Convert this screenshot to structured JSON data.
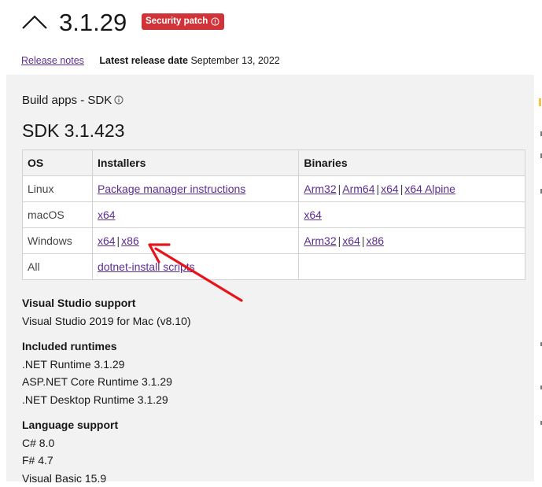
{
  "header": {
    "version": "3.1.29",
    "badge_label": "Security patch",
    "release_notes_link": "Release notes",
    "latest_release_label": "Latest release date",
    "latest_release_date": "September 13, 2022"
  },
  "sdk": {
    "section_title": "Build apps - SDK",
    "title": "SDK 3.1.423",
    "table": {
      "headers": [
        "OS",
        "Installers",
        "Binaries"
      ],
      "rows": [
        {
          "os": "Linux",
          "installers": [
            "Package manager instructions"
          ],
          "binaries": [
            "Arm32",
            "Arm64",
            "x64",
            "x64 Alpine"
          ]
        },
        {
          "os": "macOS",
          "installers": [
            "x64"
          ],
          "binaries": [
            "x64"
          ]
        },
        {
          "os": "Windows",
          "installers": [
            "x64",
            "x86"
          ],
          "binaries": [
            "Arm32",
            "x64",
            "x86"
          ]
        },
        {
          "os": "All",
          "installers": [
            "dotnet-install scripts"
          ],
          "binaries": []
        }
      ]
    },
    "vs_support": {
      "heading": "Visual Studio support",
      "items": [
        "Visual Studio 2019 for Mac (v8.10)"
      ]
    },
    "included_runtimes": {
      "heading": "Included runtimes",
      "items": [
        ".NET Runtime 3.1.29",
        "ASP.NET Core Runtime 3.1.29",
        ".NET Desktop Runtime 3.1.29"
      ]
    },
    "language_support": {
      "heading": "Language support",
      "items": [
        "C# 8.0",
        "F# 4.7",
        "Visual Basic 15.9"
      ]
    }
  },
  "colors": {
    "badge": "#d13438",
    "link": "#5c2d91",
    "arrow": "#e8141b",
    "panel": "#f2f2f2"
  },
  "icons": [
    "chevron-up-icon",
    "info-icon",
    "annotation-arrow"
  ]
}
